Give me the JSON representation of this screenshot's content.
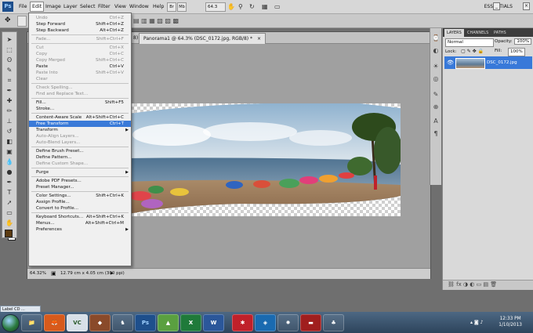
{
  "menubar": {
    "items": [
      "File",
      "Edit",
      "Image",
      "Layer",
      "Select",
      "Filter",
      "View",
      "Window",
      "Help"
    ],
    "zoom": "64.3",
    "workspace": "ESSENTIALS"
  },
  "document": {
    "tab_title": "Panorama1 @ 64.3% (DSC_0172.jpg, RGB/8) *",
    "prev_tab": "8) *",
    "zoom_status": "64.32%",
    "doc_size": "12.79 cm x 4.05 cm (300 ppi)"
  },
  "layers_panel": {
    "tabs": [
      "LAYERS",
      "CHANNELS",
      "PATHS"
    ],
    "blend_mode": "Normal",
    "opacity_label": "Opacity:",
    "opacity_value": "100%",
    "lock_label": "Lock:",
    "fill_label": "Fill:",
    "fill_value": "100%",
    "layer_name": "DSC_0172.jpg"
  },
  "edit_menu": {
    "items": [
      {
        "label": "Undo",
        "shortcut": "Ctrl+Z",
        "disabled": true
      },
      {
        "label": "Step Forward",
        "shortcut": "Shift+Ctrl+Z",
        "disabled": false
      },
      {
        "label": "Step Backward",
        "shortcut": "Alt+Ctrl+Z",
        "disabled": false
      },
      {
        "sep": true
      },
      {
        "label": "Fade...",
        "shortcut": "Shift+Ctrl+F",
        "disabled": true
      },
      {
        "sep": true
      },
      {
        "label": "Cut",
        "shortcut": "Ctrl+X",
        "disabled": true
      },
      {
        "label": "Copy",
        "shortcut": "Ctrl+C",
        "disabled": true
      },
      {
        "label": "Copy Merged",
        "shortcut": "Shift+Ctrl+C",
        "disabled": true
      },
      {
        "label": "Paste",
        "shortcut": "Ctrl+V",
        "disabled": false
      },
      {
        "label": "Paste Into",
        "shortcut": "Shift+Ctrl+V",
        "disabled": true
      },
      {
        "label": "Clear",
        "shortcut": "",
        "disabled": true
      },
      {
        "sep": true
      },
      {
        "label": "Check Spelling...",
        "shortcut": "",
        "disabled": true
      },
      {
        "label": "Find and Replace Text...",
        "shortcut": "",
        "disabled": true
      },
      {
        "sep": true
      },
      {
        "label": "Fill...",
        "shortcut": "Shift+F5",
        "disabled": false
      },
      {
        "label": "Stroke...",
        "shortcut": "",
        "disabled": false
      },
      {
        "sep": true
      },
      {
        "label": "Content-Aware Scale",
        "shortcut": "Alt+Shift+Ctrl+C",
        "disabled": false
      },
      {
        "label": "Free Transform",
        "shortcut": "Ctrl+T",
        "disabled": false,
        "highlight": true
      },
      {
        "label": "Transform",
        "shortcut": "",
        "disabled": false,
        "submenu": true
      },
      {
        "label": "Auto-Align Layers...",
        "shortcut": "",
        "disabled": true
      },
      {
        "label": "Auto-Blend Layers...",
        "shortcut": "",
        "disabled": true
      },
      {
        "sep": true
      },
      {
        "label": "Define Brush Preset...",
        "shortcut": "",
        "disabled": false
      },
      {
        "label": "Define Pattern...",
        "shortcut": "",
        "disabled": false
      },
      {
        "label": "Define Custom Shape...",
        "shortcut": "",
        "disabled": true
      },
      {
        "sep": true
      },
      {
        "label": "Purge",
        "shortcut": "",
        "disabled": false,
        "submenu": true
      },
      {
        "sep": true
      },
      {
        "label": "Adobe PDF Presets...",
        "shortcut": "",
        "disabled": false
      },
      {
        "label": "Preset Manager...",
        "shortcut": "",
        "disabled": false
      },
      {
        "sep": true
      },
      {
        "label": "Color Settings...",
        "shortcut": "Shift+Ctrl+K",
        "disabled": false
      },
      {
        "label": "Assign Profile...",
        "shortcut": "",
        "disabled": false
      },
      {
        "label": "Convert to Profile...",
        "shortcut": "",
        "disabled": false
      },
      {
        "sep": true
      },
      {
        "label": "Keyboard Shortcuts...",
        "shortcut": "Alt+Shift+Ctrl+K",
        "disabled": false
      },
      {
        "label": "Menus...",
        "shortcut": "Alt+Shift+Ctrl+M",
        "disabled": false
      },
      {
        "label": "Preferences",
        "shortcut": "",
        "disabled": false,
        "submenu": true
      }
    ]
  },
  "taskbar": {
    "label_cd": "Label CD ...",
    "apps": [
      "Windows Explorer",
      "Firefox",
      "VLC",
      "Media",
      "Photoshop",
      "App",
      "Excel",
      "Word",
      "Game",
      "App",
      "Media",
      "App",
      "Player"
    ],
    "time": "12:33 PM",
    "date": "1/10/2013"
  },
  "colors": {
    "highlight": "#3a7ad8",
    "panel_bg": "#d9d9d9",
    "workspace_bg": "#6f6f6f"
  }
}
